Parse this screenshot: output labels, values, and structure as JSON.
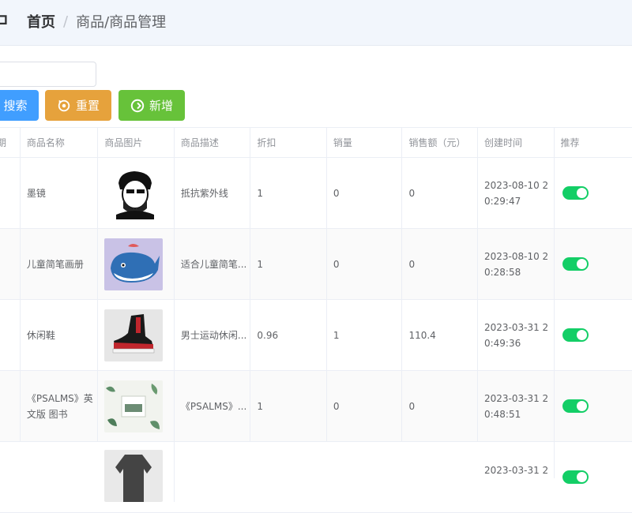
{
  "header": {
    "breadcrumb_home": "首页",
    "breadcrumb_sep": "/",
    "breadcrumb_current": "商品/商品管理"
  },
  "toolbar": {
    "search_label": "搜索",
    "reset_label": "重置",
    "add_label": "新增"
  },
  "table": {
    "columns": [
      "商品名称",
      "商品图片",
      "商品描述",
      "折扣",
      "销量",
      "销售额（元）",
      "创建时间",
      "推荐"
    ],
    "rows": [
      {
        "name": "墨镜",
        "desc": "抵抗紫外线",
        "discount": "1",
        "sales": "0",
        "revenue": "0",
        "created": "2023-08-10  2\n0:29:47",
        "recommended": true,
        "image": "man-sunglasses-icon"
      },
      {
        "name": "儿童简笔画册",
        "desc": "适合儿童简笔...",
        "discount": "1",
        "sales": "0",
        "revenue": "0",
        "created": "2023-08-10  2\n0:28:58",
        "recommended": true,
        "image": "whale-drawing-icon"
      },
      {
        "name": "休闲鞋",
        "desc": "男士运动休闲...",
        "discount": "0.96",
        "sales": "1",
        "revenue": "110.4",
        "created": "2023-03-31  2\n0:49:36",
        "recommended": true,
        "image": "sneaker-icon"
      },
      {
        "name": "《PSALMS》英\n文版 图书",
        "desc": "《PSALMS》...",
        "discount": "1",
        "sales": "0",
        "revenue": "0",
        "created": "2023-03-31  2\n0:48:51",
        "recommended": true,
        "image": "book-cover-icon"
      }
    ],
    "partial_row_created": "2023-03-31  2"
  },
  "colors": {
    "primary": "#409eff",
    "warning": "#e6a23c",
    "success": "#67c23a",
    "switch_on": "#13ce66"
  }
}
